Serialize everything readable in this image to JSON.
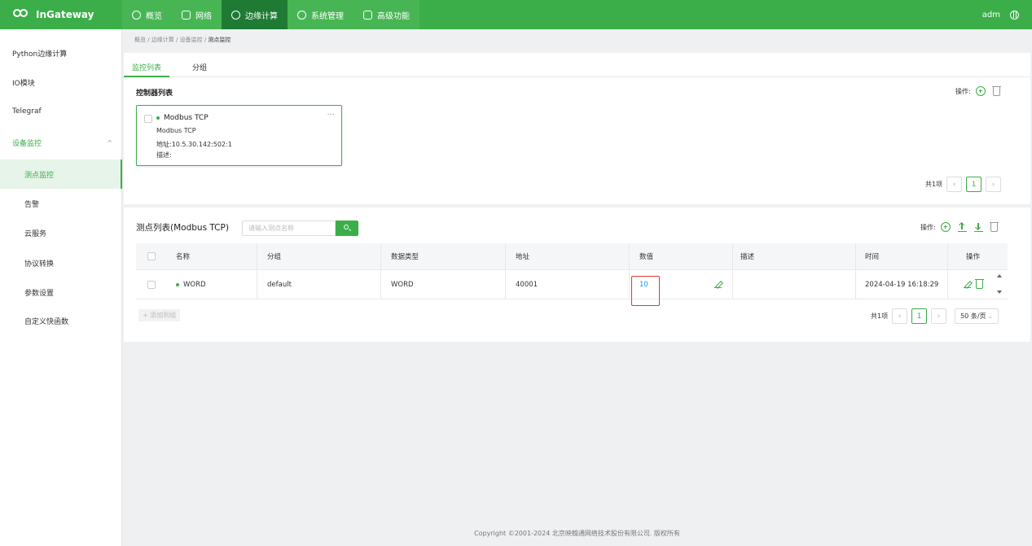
{
  "app": {
    "logo_sub": "inhand",
    "logo_name": "InGateway",
    "user": "adm"
  },
  "nav": [
    {
      "label": "概览",
      "icon": "dashboard-icon"
    },
    {
      "label": "网络",
      "icon": "network-icon"
    },
    {
      "label": "边缘计算",
      "icon": "cloud-icon"
    },
    {
      "label": "系统管理",
      "icon": "gear-icon"
    },
    {
      "label": "高级功能",
      "icon": "grid-icon"
    }
  ],
  "sidebar": {
    "items": [
      {
        "label": "Python边缘计算"
      },
      {
        "label": "IO模块"
      },
      {
        "label": "Telegraf"
      },
      {
        "label": "设备监控"
      },
      {
        "label": "测点监控"
      },
      {
        "label": "告警"
      },
      {
        "label": "云服务"
      },
      {
        "label": "协议转换"
      },
      {
        "label": "参数设置"
      },
      {
        "label": "自定义快函数"
      }
    ]
  },
  "breadcrumb": [
    "概览",
    "边缘计算",
    "设备监控",
    "测点监控"
  ],
  "tabs": [
    "监控列表",
    "分组"
  ],
  "controllers": {
    "title": "控制器列表",
    "ops_label": "操作:",
    "card": {
      "name": "Modbus TCP",
      "protocol": "Modbus TCP",
      "address": "地址:10.5.30.142:502:1",
      "desc": "描述:",
      "more": "···"
    },
    "pager": {
      "total": "共1项",
      "page": "1"
    }
  },
  "points": {
    "title": "测点列表(Modbus TCP)",
    "search_placeholder": "请输入测点名称",
    "ops_label": "操作:",
    "columns": [
      "名称",
      "分组",
      "数据类型",
      "地址",
      "数值",
      "描述",
      "时间",
      "操作"
    ],
    "rows": [
      {
        "name": "WORD",
        "group": "default",
        "type": "WORD",
        "address": "40001",
        "value": "10",
        "desc": "",
        "time": "2024-04-19 16:18:29"
      }
    ],
    "add_group": "+ 添加到组",
    "pager": {
      "total": "共1项",
      "page": "1",
      "size": "50 条/页"
    }
  },
  "footer": "Copyright ©2001-2024 北京映翰通网络技术股份有限公司. 版权所有",
  "colors": {
    "brand": "#3bae49",
    "nav_active": "#1f7a33",
    "link": "#1890ff",
    "highlight": "#e5362f"
  }
}
